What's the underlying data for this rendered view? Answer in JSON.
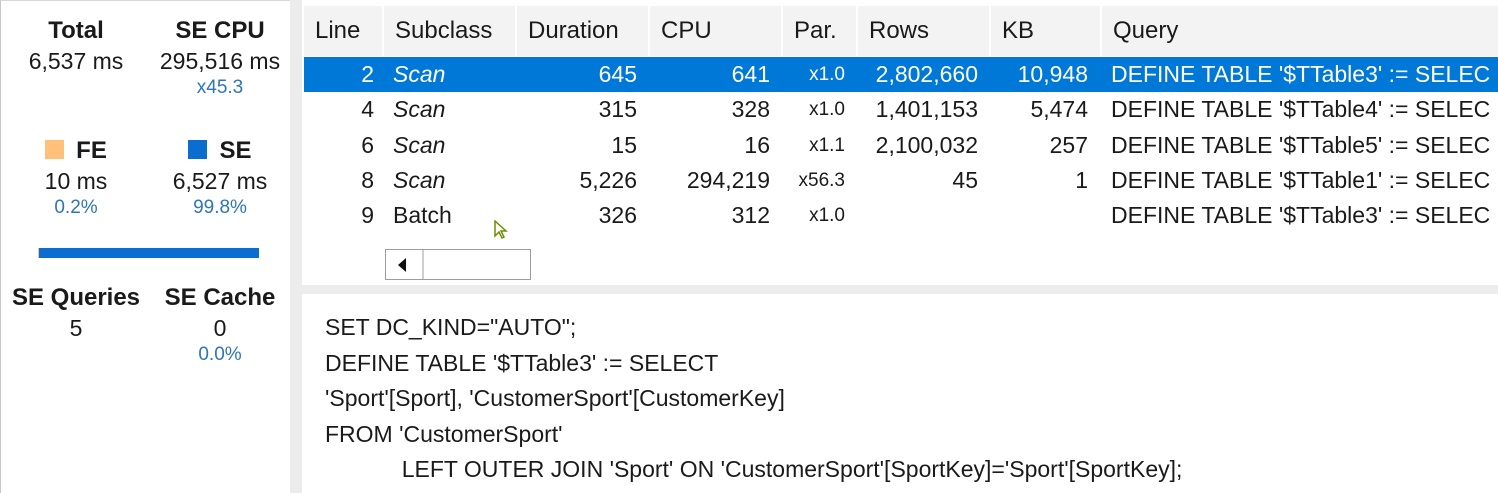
{
  "stats": {
    "total": {
      "label": "Total",
      "value": "6,537 ms"
    },
    "se_cpu": {
      "label": "SE CPU",
      "value": "295,516 ms",
      "sub": "x45.3"
    },
    "fe": {
      "label": "FE",
      "value": "10 ms",
      "pct": "0.2%",
      "color": "#ffc07a",
      "fraction": 0.002
    },
    "se": {
      "label": "SE",
      "value": "6,527 ms",
      "pct": "99.8%",
      "color": "#0a6ed1",
      "fraction": 0.998
    },
    "se_queries": {
      "label": "SE Queries",
      "value": "5"
    },
    "se_cache": {
      "label": "SE Cache",
      "value": "0",
      "pct": "0.0%"
    }
  },
  "grid": {
    "columns": [
      "Line",
      "Subclass",
      "Duration",
      "CPU",
      "Par.",
      "Rows",
      "KB",
      "Query"
    ],
    "rows": [
      {
        "line": "2",
        "subclass": "Scan",
        "duration": "645",
        "cpu": "641",
        "par": "x1.0",
        "rows": "2,802,660",
        "kb": "10,948",
        "query": "DEFINE TABLE '$TTable3' := SELEC",
        "selected": true
      },
      {
        "line": "4",
        "subclass": "Scan",
        "duration": "315",
        "cpu": "328",
        "par": "x1.0",
        "rows": "1,401,153",
        "kb": "5,474",
        "query": "DEFINE TABLE '$TTable4' := SELEC"
      },
      {
        "line": "6",
        "subclass": "Scan",
        "duration": "15",
        "cpu": "16",
        "par": "x1.1",
        "rows": "2,100,032",
        "kb": "257",
        "query": "DEFINE TABLE '$TTable5' := SELEC"
      },
      {
        "line": "8",
        "subclass": "Scan",
        "duration": "5,226",
        "cpu": "294,219",
        "par": "x56.3",
        "rows": "45",
        "kb": "1",
        "query": "DEFINE TABLE '$TTable1' := SELEC"
      },
      {
        "line": "9",
        "subclass": "Batch",
        "duration": "326",
        "cpu": "312",
        "par": "x1.0",
        "rows": "",
        "kb": "",
        "query": "DEFINE TABLE '$TTable3' := SELEC"
      }
    ]
  },
  "query_text": [
    "SET DC_KIND=\"AUTO\";",
    "DEFINE TABLE '$TTable3' := SELECT",
    "'Sport'[Sport], 'CustomerSport'[CustomerKey]",
    "FROM 'CustomerSport'",
    "\t\tLEFT OUTER JOIN 'Sport' ON 'CustomerSport'[SportKey]='Sport'[SportKey];"
  ]
}
